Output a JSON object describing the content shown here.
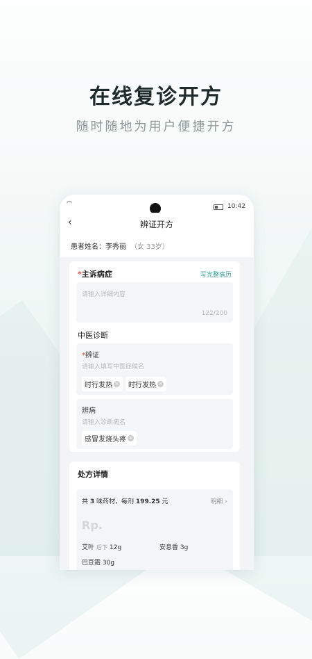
{
  "headline": "在线复诊开方",
  "subheadline": "随时随地为用户便捷开方",
  "status_bar": {
    "time": "10:42"
  },
  "nav": {
    "title": "辨证开方"
  },
  "patient": {
    "label": "患者姓名：李秀丽",
    "meta": "（女 33岁）"
  },
  "complaint": {
    "required_mark": "*",
    "title": "主诉病症",
    "link": "写完整病历",
    "placeholder": "请输入详细内容",
    "count": "122/200"
  },
  "tcm": {
    "title": "中医诊断",
    "syndrome": {
      "required_mark": "*",
      "label": "辨证",
      "placeholder": "请输入填写中医症候名",
      "tags": [
        "时行发热",
        "时行发热"
      ]
    },
    "disease": {
      "label": "辨病",
      "placeholder": "请输入诊断病名",
      "tags": [
        "感冒发烧头疼"
      ]
    }
  },
  "prescription": {
    "title": "处方详情",
    "summary_prefix": "共",
    "herb_count": "3",
    "summary_mid": "味药材，每剂",
    "price": "199.25",
    "summary_unit": "元",
    "detail_link": "明细",
    "rp": "Rp.",
    "herbs": [
      {
        "name": "艾叶",
        "note": "后下",
        "dose": "12g"
      },
      {
        "name": "安息香",
        "note": "",
        "dose": "3g"
      },
      {
        "name": "巴豆霜",
        "note": "",
        "dose": "30g"
      }
    ]
  }
}
